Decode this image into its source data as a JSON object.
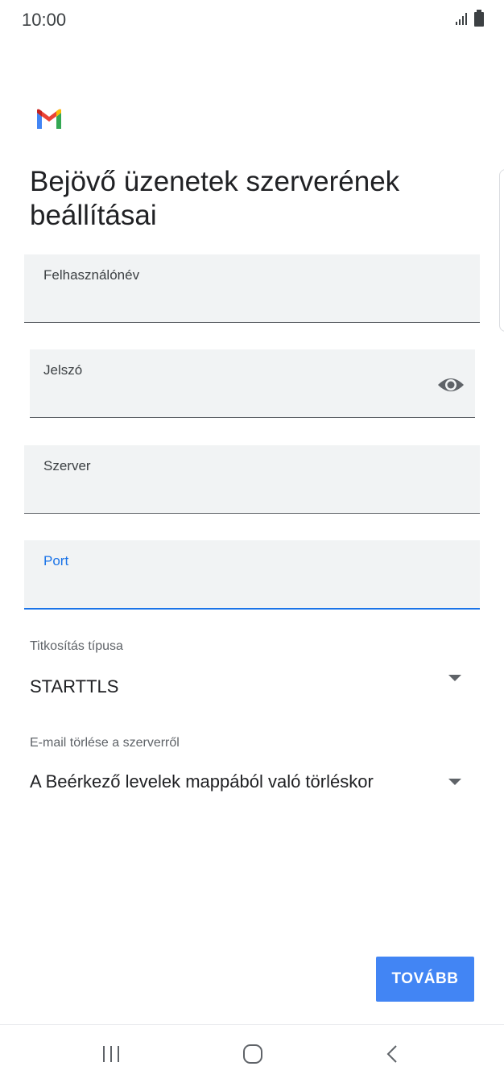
{
  "status_bar": {
    "time": "10:00",
    "signal_icon": "signal-icon",
    "battery_icon": "battery-icon"
  },
  "app": {
    "logo": "gmail-logo-icon"
  },
  "page": {
    "title": "Bejövő üzenetek szerverének beállításai"
  },
  "fields": {
    "username": {
      "label": "Felhasználónév",
      "value": ""
    },
    "password": {
      "label": "Jelszó",
      "value": "",
      "toggle_icon": "eye-icon"
    },
    "server": {
      "label": "Szerver",
      "value": ""
    },
    "port": {
      "label": "Port",
      "value": ""
    }
  },
  "encryption": {
    "label": "Titkosítás típusa",
    "value": "STARTTLS"
  },
  "delete_from_server": {
    "label": "E-mail törlése a szerverről",
    "value": "A Beérkező levelek mappából való törléskor"
  },
  "actions": {
    "next_label": "TOVÁBB"
  },
  "nav": {
    "recents_icon": "recents-icon",
    "home_icon": "home-icon",
    "back_icon": "back-icon"
  },
  "colors": {
    "accent": "#1a73e8",
    "button": "#4285f4",
    "field_bg": "#f1f3f4"
  }
}
